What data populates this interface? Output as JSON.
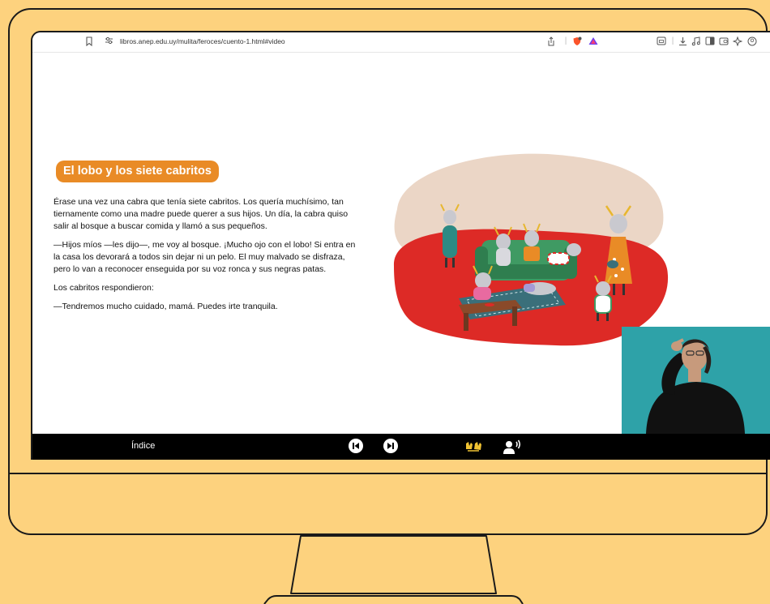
{
  "browser": {
    "url": "libros.anep.edu.uy/mulita/feroces/cuento-1.html#video"
  },
  "story": {
    "title": "El lobo y los siete cabritos",
    "paragraphs": [
      "Érase una vez una cabra que tenía siete cabritos. Los quería muchísimo, tan tiernamente como una madre puede querer a sus hijos. Un día, la cabra quiso salir al bosque a buscar comida y llamó a sus pequeños.",
      "—Hijos míos —les dijo—, me voy al bosque. ¡Mucho ojo con el lobo! Si entra en la casa los devorará a todos sin dejar ni un pelo. El muy malvado se disfraza, pero lo van a reconocer enseguida por su voz ronca y sus negras patas.",
      "Los cabritos respondieron:",
      "—Tendremos mucho cuidado, mamá. Puedes irte tranquila."
    ]
  },
  "bottom_bar": {
    "index_label": "Índice"
  },
  "icons": {
    "bookmark": "bookmark-icon",
    "site_settings": "site-settings-icon",
    "share": "share-icon",
    "brave_shield": "brave-shield-icon",
    "brave_rewards": "brave-rewards-icon",
    "sidebar": "sidebar-icon",
    "download": "download-icon",
    "media": "music-icon",
    "reader": "reader-icon",
    "wallet": "wallet-icon",
    "leo": "leo-icon",
    "prev": "previous-icon",
    "next": "next-icon",
    "sign_language": "sign-language-icon",
    "audio": "audio-narration-icon"
  },
  "colors": {
    "background": "#fdd27e",
    "title_pill": "#e98b26",
    "illustration_floor": "#dd2a26",
    "illustration_backdrop": "#ebd6c6",
    "sign_icon": "#f0c232",
    "video_bg": "#2ea2a8"
  }
}
